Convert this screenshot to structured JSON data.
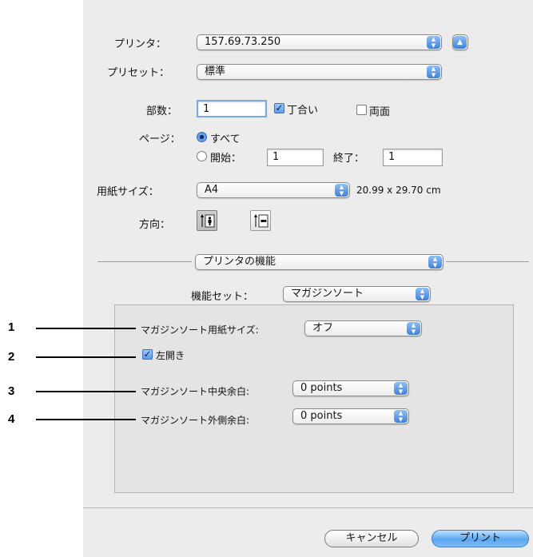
{
  "printer": {
    "label": "プリンタ：",
    "value": "157.69.73.250"
  },
  "preset": {
    "label": "プリセット：",
    "value": "標準"
  },
  "copies": {
    "label": "部数：",
    "value": "1",
    "collated_label": "丁合い",
    "collated": true,
    "duplex_label": "両面",
    "duplex": false
  },
  "pages": {
    "label": "ページ：",
    "all_label": "すべて",
    "from_label": "開始：",
    "from_value": "1",
    "to_label": "終了：",
    "to_value": "1",
    "selected": "all"
  },
  "paper": {
    "label": "用紙サイズ：",
    "value": "A4",
    "dimensions": "20.99 x 29.70 cm"
  },
  "orientation": {
    "label": "方向：",
    "selected": "portrait"
  },
  "section": {
    "value": "プリンタの機能"
  },
  "feature_set": {
    "label": "機能セット：",
    "value": "マガジンソート"
  },
  "magazine": {
    "paper_size_label": "マガジンソート用紙サイズ:",
    "paper_size_value": "オフ",
    "left_open_label": "左開き",
    "left_open": true,
    "center_margin_label": "マガジンソート中央余白:",
    "center_margin_value": "0 points",
    "outer_margin_label": "マガジンソート外側余白:",
    "outer_margin_value": "0 points"
  },
  "callouts": [
    "1",
    "2",
    "3",
    "4"
  ],
  "buttons": {
    "cancel": "キャンセル",
    "print": "プリント"
  },
  "colors": {
    "accent": "#4a8de0",
    "dialog_bg": "#ececec"
  }
}
